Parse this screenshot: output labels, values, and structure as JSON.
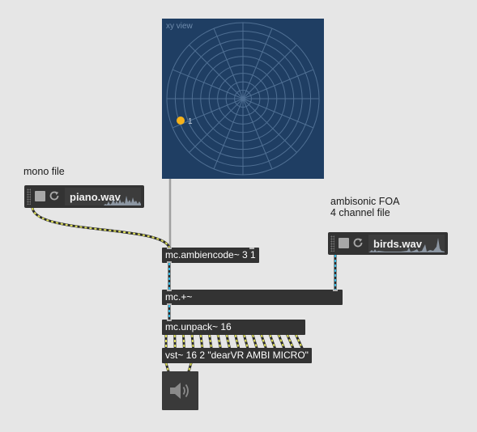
{
  "comments": {
    "mono": "mono file",
    "ambi_line1": "ambisonic FOA",
    "ambi_line2": "4 channel file"
  },
  "xy_view": {
    "label": "xy view",
    "source_label": "1",
    "source_color": "#f5b21b",
    "background": "#1f3e63",
    "grid_color": "#4f6f93"
  },
  "players": {
    "piano": {
      "file": "piano.wav"
    },
    "birds": {
      "file": "birds.wav"
    }
  },
  "objects": {
    "ambiencode": "mc.ambiencode~ 3 1",
    "plus": "mc.+~",
    "unpack": "mc.unpack~ 16",
    "vst": "vst~ 16 2 \"dearVR AMBI MICRO\""
  },
  "icons": {
    "stop": "stop-icon",
    "loop": "loop-icon",
    "speaker": "speaker-icon"
  },
  "colors": {
    "patch_background": "#e6e6e6",
    "object_box": "#333333",
    "audio_cord_dash": "#dfe05a",
    "mc_cord_dash": "#35b7e0",
    "control_cord": "#a0a0a0"
  }
}
